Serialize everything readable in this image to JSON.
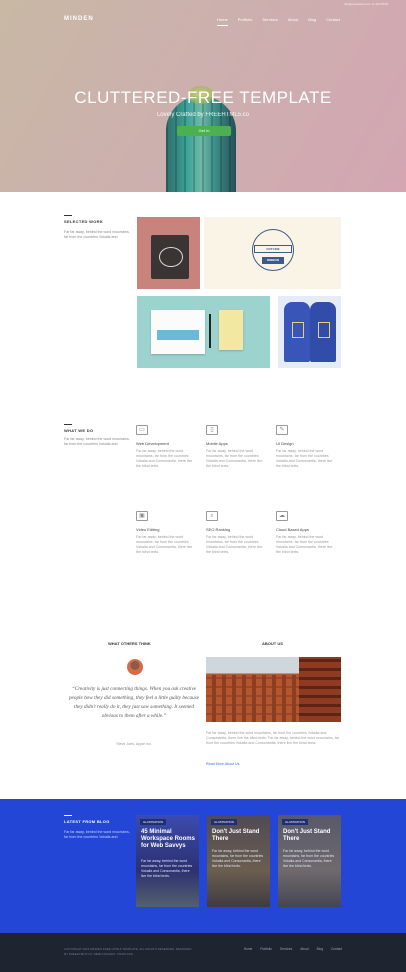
{
  "brand": "MINDEN",
  "top_contacts": "info@company.com   +1 234 5678",
  "nav": [
    "Home",
    "Portfolio",
    "Services",
    "About",
    "Blog",
    "Contact"
  ],
  "hero": {
    "title": "CLUTTERED-FREE TEMPLATE",
    "subtitle": "Lovely Crafted by FREEHTML5.co",
    "button": "Get In"
  },
  "work": {
    "label": "SELECTED WORK",
    "blurb": "Far far away, behind the word mountains, far from the countries Vokalia and",
    "tiles": [
      {
        "name": "tote-bag",
        "caption": ""
      },
      {
        "name": "outline-ribbon",
        "caption": "OUTLINE",
        "caption2": "RIBBON"
      },
      {
        "name": "stationery",
        "caption": ""
      },
      {
        "name": "tank-tops",
        "caption": ""
      }
    ]
  },
  "services": {
    "label": "WHAT WE DO",
    "blurb": "Far far away, behind the word mountains, far from the countries Vokalia and",
    "items": [
      {
        "icon": "window-icon",
        "glyph": "▭",
        "title": "Web Development",
        "text": "Far far away, behind the word mountains, far from the countries Vokalia and Consonantia, there live the blind texts."
      },
      {
        "icon": "phone-icon",
        "glyph": "▯",
        "title": "Mobile Apps",
        "text": "Far far away, behind the word mountains, far from the countries Vokalia and Consonantia, there live the blind texts."
      },
      {
        "icon": "pencil-icon",
        "glyph": "✎",
        "title": "UI Design",
        "text": "Far far away, behind the word mountains, far from the countries Vokalia and Consonantia, there live the blind texts."
      },
      {
        "icon": "video-icon",
        "glyph": "▣",
        "title": "Video Editing",
        "text": "Far far away, behind the word mountains, far from the countries Vokalia and Consonantia, there live the blind texts."
      },
      {
        "icon": "search-icon",
        "glyph": "⌕",
        "title": "SEO Ranking",
        "text": "Far far away, behind the word mountains, far from the countries Vokalia and Consonantia, there live the blind texts."
      },
      {
        "icon": "cloud-icon",
        "glyph": "☁",
        "title": "Cloud Based Apps",
        "text": "Far far away, behind the word mountains, far from the countries Vokalia and Consonantia, there live the blind texts."
      }
    ]
  },
  "testimonial": {
    "label": "WHAT OTHERS THINK",
    "quote": "“Creativity is just connecting things. When you ask creative people how they did something, they feel a little guilty because they didn't really do it, they just saw something. It seemed obvious to them after a while.”",
    "author": "Steve Jobs, Apple Inc."
  },
  "about": {
    "label": "ABOUT US",
    "text": "Far far away, behind the word mountains, far from the countries Vokalia and Consonantia, there live the blind texts. Far far away, behind the word mountains, far from the countries Vokalia and Consonantia, there live the blind texts.",
    "link": "Read More About Us"
  },
  "blog": {
    "label": "LATEST FROM BLOG",
    "blurb": "Far far away, behind the word mountains, far from the countries Vokalia and",
    "posts": [
      {
        "tag": "ILLUSTRATION",
        "title": "45 Minimal Workspace Rooms for Web Savvys",
        "text": "Far far away, behind the word mountains, far from the countries Vokalia and Consonantia, there live the blind texts."
      },
      {
        "tag": "ILLUSTRATION",
        "title": "Don't Just Stand There",
        "text": "Far far away, behind the word mountains, far from the countries Vokalia and Consonantia, there live the blind texts."
      },
      {
        "tag": "ILLUSTRATION",
        "title": "Don't Just Stand There",
        "text": "Far far away, behind the word mountains, far from the countries Vokalia and Consonantia, there live the blind texts."
      }
    ]
  },
  "footer": {
    "text": "COPYRIGHT 2016 MINDEN FREE HTML5 TEMPLATE. ALL RIGHTS RESERVED. DESIGNED BY FREEHTML5.CO. DEMO IMAGES: UNSPLASH",
    "nav": [
      "Home",
      "Portfolio",
      "Services",
      "About",
      "Blog",
      "Contact"
    ]
  }
}
